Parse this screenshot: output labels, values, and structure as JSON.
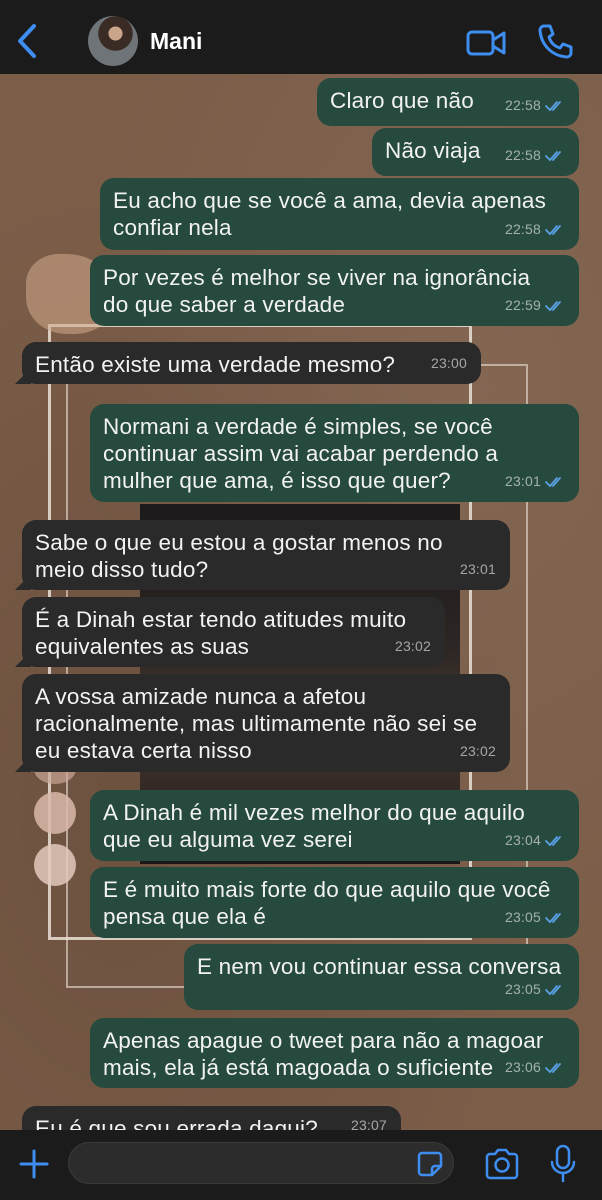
{
  "header": {
    "contact_name": "Mani"
  },
  "composer": {
    "placeholder": ""
  },
  "messages": [
    {
      "dir": "out",
      "text": "Claro que não",
      "time": "22:58",
      "read": true
    },
    {
      "dir": "out",
      "text": "Não viaja",
      "time": "22:58",
      "read": true
    },
    {
      "dir": "out",
      "text": "Eu acho que se você a ama, devia apenas\nconfiar nela",
      "time": "22:58",
      "read": true
    },
    {
      "dir": "out",
      "text": "Por vezes é melhor se viver na ignorância\ndo que saber a verdade",
      "time": "22:59",
      "read": true
    },
    {
      "dir": "in",
      "text": "Então existe uma verdade mesmo?",
      "time": "23:00"
    },
    {
      "dir": "out",
      "text": "Normani a verdade é simples, se você\ncontinuar assim vai acabar perdendo a\nmulher que ama, é isso que quer?",
      "time": "23:01",
      "read": true
    },
    {
      "dir": "in",
      "text": "Sabe o que eu estou a gostar menos no\nmeio disso tudo?",
      "time": "23:01"
    },
    {
      "dir": "in",
      "text": "É a Dinah estar tendo atitudes muito\nequivalentes as suas",
      "time": "23:02"
    },
    {
      "dir": "in",
      "text": "A vossa amizade nunca a afetou\nracionalmente, mas ultimamente não sei se\neu estava certa nisso",
      "time": "23:02"
    },
    {
      "dir": "out",
      "text": "A Dinah é mil vezes melhor do que aquilo\nque eu alguma vez serei",
      "time": "23:04",
      "read": true
    },
    {
      "dir": "out",
      "text": "E é muito mais forte do que aquilo que você\npensa que ela é",
      "time": "23:05",
      "read": true
    },
    {
      "dir": "out",
      "text": "E nem vou continuar essa conversa",
      "time": "23:05",
      "read": true
    },
    {
      "dir": "out",
      "text": "Apenas apague o tweet para não a magoar\nmais, ela já está magoada o suficiente",
      "time": "23:06",
      "read": true
    },
    {
      "dir": "in",
      "text": "Eu é que sou errada daqui?",
      "time": "23:07"
    }
  ],
  "colors": {
    "accent": "#3d8ef0",
    "outgoing_bubble": "#264a3d",
    "incoming_bubble": "#2a2a2a",
    "read_ticks": "#5aa0e6"
  },
  "icons": [
    "back-chevron-icon",
    "video-camera-icon",
    "phone-icon",
    "plus-icon",
    "sticker-icon",
    "camera-icon",
    "microphone-icon",
    "read-ticks-icon"
  ]
}
